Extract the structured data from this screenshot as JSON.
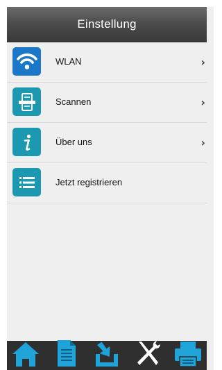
{
  "header": {
    "title": "Einstellung"
  },
  "menu": {
    "items": [
      {
        "label": "WLAN",
        "icon": "wifi-icon",
        "color": "#1b78c8",
        "has_chevron": true
      },
      {
        "label": "Scannen",
        "icon": "scanner-icon",
        "color": "#1c98b0",
        "has_chevron": true
      },
      {
        "label": "Über uns",
        "icon": "info-icon",
        "color": "#1c98b0",
        "has_chevron": true
      },
      {
        "label": "Jetzt registrieren",
        "icon": "list-icon",
        "color": "#1c98b0",
        "has_chevron": false
      }
    ],
    "chevron": "›"
  },
  "bottom_nav": {
    "items": [
      {
        "icon": "home-icon"
      },
      {
        "icon": "document-icon"
      },
      {
        "icon": "download-icon"
      },
      {
        "icon": "tools-icon"
      },
      {
        "icon": "printer-icon"
      }
    ],
    "accent": "#1ea4d8"
  }
}
